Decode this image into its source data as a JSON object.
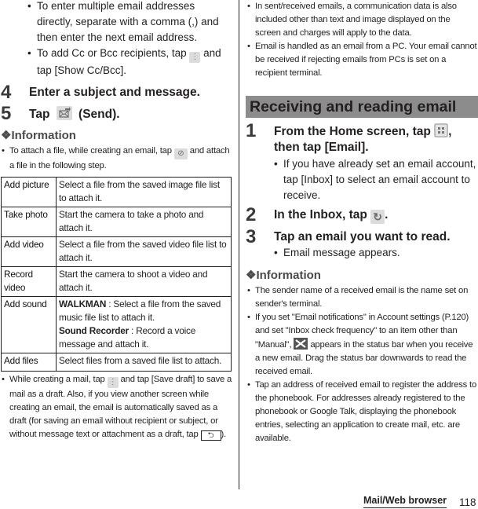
{
  "left_column": {
    "top_bullets": [
      "To enter multiple email addresses directly, separate with a comma (,) and then enter the next email address.",
      {
        "before": "To add Cc or Bcc recipients, tap",
        "icon": "menu-icon",
        "after": "and tap [Show Cc/Bcc]."
      }
    ],
    "steps": [
      {
        "number": "4",
        "text": "Enter a subject and message."
      },
      {
        "number": "5",
        "before": "Tap",
        "icon": "send-icon",
        "after": "(Send)."
      }
    ],
    "information": {
      "title": "Information",
      "marker": "❖",
      "bullet_1": {
        "before": "To attach a file, while creating an email, tap",
        "icon": "attach-icon",
        "after": "and attach a file in the following step."
      },
      "table": [
        {
          "key": "Add picture",
          "value": "Select a file from the saved image file list to attach it."
        },
        {
          "key": "Take photo",
          "value": "Start the camera to take a photo and attach it."
        },
        {
          "key": "Add video",
          "value": "Select a file from the saved video file list to attach it."
        },
        {
          "key": "Record video",
          "value": "Start the camera to shoot a video and attach it."
        },
        {
          "key": "Add sound",
          "sub": [
            {
              "bold": "WALKMAN",
              "text": " : Select a file from the saved music file list to attach it."
            },
            {
              "bold": "Sound Recorder",
              "text": " : Record a voice message and attach it."
            }
          ]
        },
        {
          "key": "Add files",
          "value": "Select files from a saved file list to attach."
        }
      ],
      "bullet_2": {
        "before": "While creating a mail, tap",
        "icon": "menu-icon",
        "middle": "and tap [Save draft] to save a mail as a draft. Also, if you view another screen while creating an email, the email is automatically saved as a draft (for saving an email without recipient or subject, or without message text or attachment as a draft, tap",
        "icon2": "back-key-icon",
        "after": ")."
      }
    }
  },
  "right_column": {
    "top_bullets": [
      "In sent/received emails, a communication data is also included other than text and image displayed on the screen and charges will apply to the data.",
      "Email is handled as an email from a PC. Your email cannot be received if rejecting emails from PCs is set on a recipient terminal."
    ],
    "section_title": "Receiving and reading email",
    "steps": [
      {
        "number": "1",
        "before": "From the Home screen, tap",
        "icon": "apps-icon",
        "after": ", then tap [Email].",
        "bullet": "If you have already set an email account, tap [Inbox] to select an email account to receive."
      },
      {
        "number": "2",
        "before": "In the Inbox, tap",
        "icon": "refresh-icon",
        "after": "."
      },
      {
        "number": "3",
        "text": "Tap an email you want to read.",
        "bullet": "Email message appears."
      }
    ],
    "information": {
      "title": "Information",
      "marker": "❖",
      "bullets": [
        {
          "text": "The sender name of a received email is the name set on sender's terminal."
        },
        {
          "before": "If you set \"Email notifications\" in Account settings (P.120) and set \"Inbox check frequency\" to an item other than \"Manual\",",
          "icon": "new-email-status-icon",
          "after": "appears in the status bar when you receive a new email. Drag the status bar downwards to read the received email."
        },
        {
          "text": "Tap an address of received email to register the address to the phonebook. For addresses already registered to the phonebook or Google Talk, displaying the phonebook entries, selecting an application to create mail, etc. are available."
        }
      ]
    }
  },
  "footer": {
    "section_label": "Mail/Web browser",
    "page_number": "118"
  }
}
